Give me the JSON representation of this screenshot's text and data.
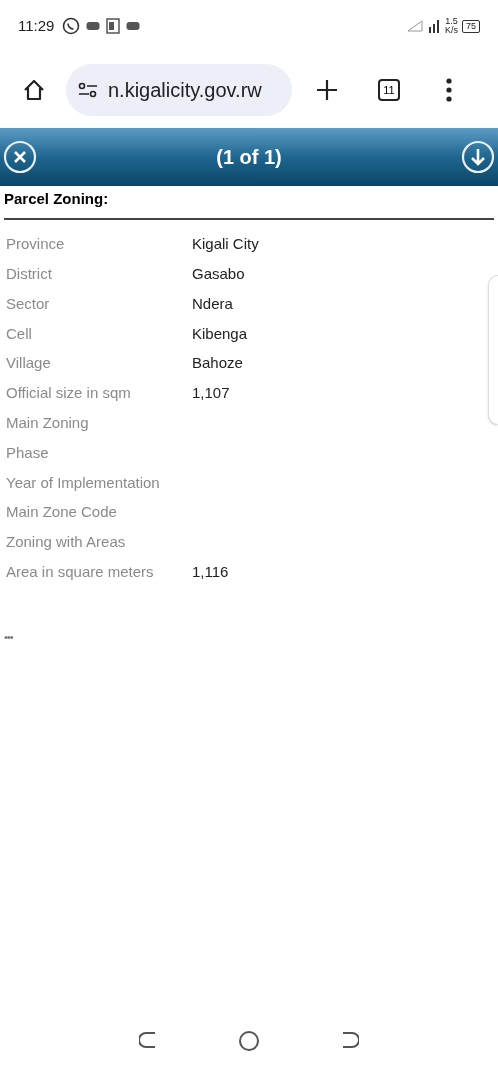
{
  "status_bar": {
    "time": "11:29",
    "net_speed": "1.5",
    "net_unit": "K/s",
    "battery": "75"
  },
  "browser": {
    "url": "n.kigalicity.gov.rw",
    "tab_count": "11"
  },
  "popup": {
    "header": "(1 of 1)",
    "title": "Parcel Zoning:",
    "rows": [
      {
        "label": "Province",
        "value": "Kigali City"
      },
      {
        "label": "District",
        "value": "Gasabo"
      },
      {
        "label": "Sector",
        "value": "Ndera"
      },
      {
        "label": "Cell",
        "value": "Kibenga"
      },
      {
        "label": "Village",
        "value": "Bahoze"
      },
      {
        "label": "Official size in sqm",
        "value": "1,107"
      },
      {
        "label": "Main Zoning"
      },
      {
        "label": "Phase"
      },
      {
        "label": "Year of Implementation"
      },
      {
        "label": "Main Zone Code"
      },
      {
        "label": "Zoning with Areas"
      },
      {
        "label": "Area in square meters",
        "value": "1,116"
      }
    ],
    "more": "•••"
  }
}
